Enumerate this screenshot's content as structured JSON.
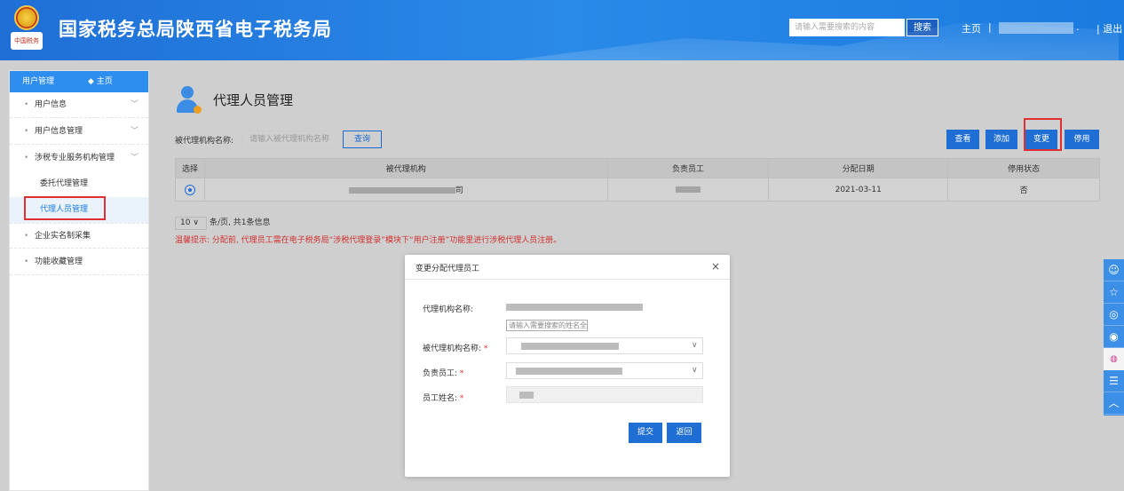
{
  "header": {
    "emblem_text": "中国税务",
    "title": "国家税务总局陕西省电子税务局",
    "search_placeholder": "请输入需要搜索的内容",
    "search_label": "搜索",
    "home_label": "主页",
    "separator": "|",
    "dot": ".",
    "logout_label": "| 退出"
  },
  "sidebar": {
    "header_title": "用户管理",
    "home_link": "◆ 主页",
    "items": [
      {
        "label": "用户信息"
      },
      {
        "label": "用户信息管理"
      },
      {
        "label": "涉税专业服务机构管理"
      }
    ],
    "sub_items": [
      {
        "label": "委托代理管理"
      },
      {
        "label": "代理人员管理"
      }
    ],
    "items_after": [
      {
        "label": "企业实名制采集"
      },
      {
        "label": "功能收藏管理"
      }
    ]
  },
  "main": {
    "page_title": "代理人员管理",
    "filter_label": "被代理机构名称:",
    "filter_placeholder": "请输入被代理机构名称",
    "query_label": "查询",
    "toolbar": {
      "view": "查看",
      "add": "添加",
      "edit": "变更",
      "disable": "停用"
    },
    "table": {
      "headers": [
        "选择",
        "被代理机构",
        "负责员工",
        "分配日期",
        "停用状态"
      ],
      "rows": [
        {
          "org_suffix": "司",
          "date": "2021-03-11",
          "status": "否"
        }
      ]
    },
    "pager": {
      "page_size": "10",
      "text": "条/页, 共1条信息"
    },
    "tip": "温馨提示: 分配前, 代理员工需在电子税务局“涉税代理登录”模块下“用户注册”功能里进行涉税代理人员注册。"
  },
  "modal": {
    "title": "变更分配代理员工",
    "close": "×",
    "agency_label": "代理机构名称:",
    "search_name_placeholder": "请输入需要搜索的姓名全",
    "org_label": "被代理机构名称:",
    "employee_label": "负责员工:",
    "name_label": "员工姓名:",
    "required_mark": "*",
    "submit_label": "提交",
    "back_label": "返回"
  },
  "right_tools": [
    "user-icon",
    "star-icon",
    "chat-icon",
    "weibo-icon",
    "headset-icon",
    "notes-icon",
    "arrow-up-icon"
  ],
  "colors": {
    "header_blue": "#1f6fd6",
    "primary_button": "#1f6ed4",
    "highlight_red": "#e03030",
    "tip_red": "#d23030"
  }
}
